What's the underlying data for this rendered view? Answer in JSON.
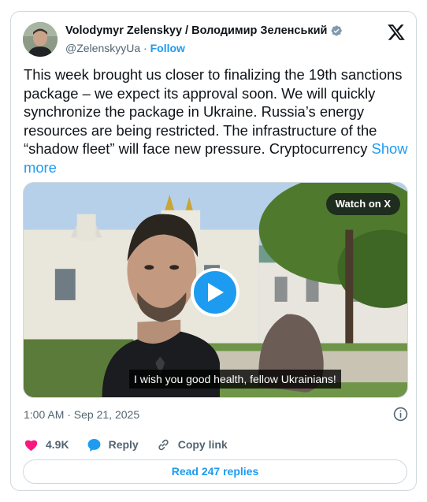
{
  "author": {
    "display_name": "Volodymyr Zelenskyy / Володимир Зеленський",
    "handle": "@ZelenskyyUa",
    "separator": "·",
    "follow_label": "Follow",
    "verified_icon": "verified-badge-icon"
  },
  "platform_logo": "x-logo-icon",
  "tweet": {
    "text": "This week brought us closer to finalizing the 19th sanctions package – we expect its approval soon. We will quickly synchronize the package in Ukraine. Russia’s energy resources are being restricted. The infrastructure of the “shadow fleet” will face new pressure. Cryptocurrency ",
    "show_more_label": "Show more"
  },
  "media": {
    "watch_label": "Watch on X",
    "caption": "I wish you good health, fellow Ukrainians!",
    "play_icon": "play-icon"
  },
  "meta": {
    "timestamp": "1:00 AM · Sep 21, 2025",
    "info_icon": "info-icon"
  },
  "actions": {
    "likes_count": "4.9K",
    "reply_label": "Reply",
    "copy_link_label": "Copy link"
  },
  "footer": {
    "read_replies_label": "Read 247 replies"
  },
  "colors": {
    "accent": "#1d9bf0",
    "like": "#f91880",
    "text": "#0f1419",
    "secondary": "#536471",
    "border": "#cfd9de"
  }
}
